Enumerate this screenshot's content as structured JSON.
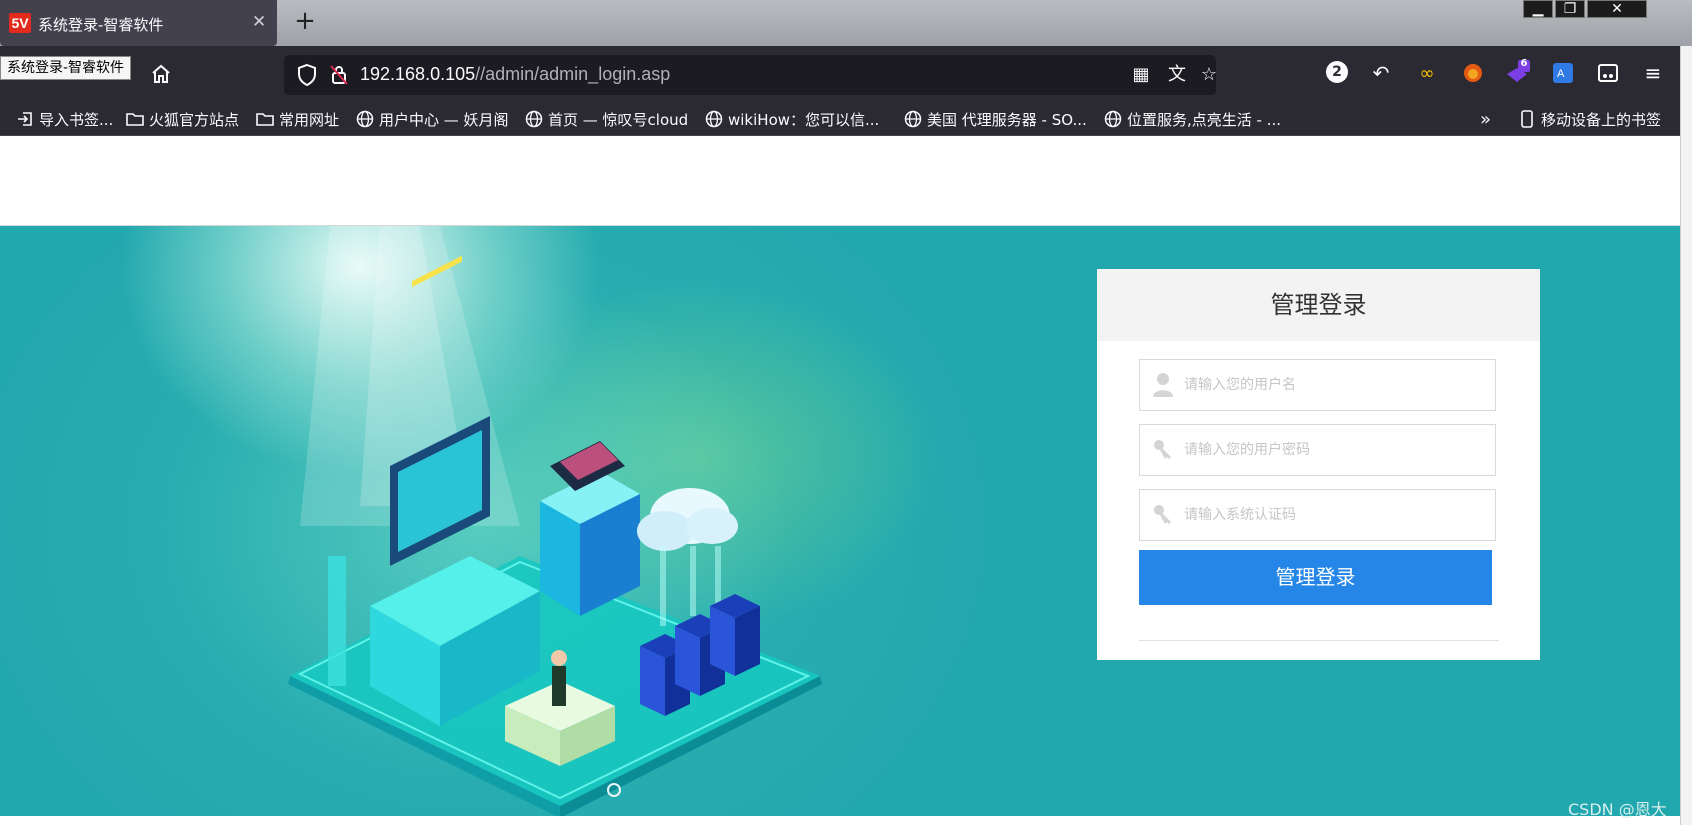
{
  "browser": {
    "tab_title": "系统登录-智睿软件",
    "tab_favicon_text": "5V",
    "tooltip": "系统登录-智睿软件",
    "url_host": "192.168.0.105",
    "url_path": "//admin/admin_login.asp",
    "badge_count": "2",
    "extension_badge": "6",
    "bookmarks": [
      {
        "label": "导入书签...",
        "icon": "import-icon"
      },
      {
        "label": "火狐官方站点",
        "icon": "folder-icon"
      },
      {
        "label": "常用网址",
        "icon": "folder-icon"
      },
      {
        "label": "用户中心 — 妖月阁",
        "icon": "globe-icon"
      },
      {
        "label": "首页 — 惊叹号cloud",
        "icon": "globe-icon"
      },
      {
        "label": "wikiHow：您可以信...",
        "icon": "globe-icon"
      },
      {
        "label": "美国 代理服务器 - SO...",
        "icon": "globe-icon"
      },
      {
        "label": "位置服务,点亮生活 - ...",
        "icon": "globe-icon"
      }
    ],
    "mobile_bookmarks": "移动设备上的书签"
  },
  "login": {
    "title": "管理登录",
    "username_placeholder": "请输入您的用户名",
    "password_placeholder": "请输入您的用户密码",
    "captcha_placeholder": "请输入系统认证码",
    "submit_label": "管理登录"
  },
  "watermark": "CSDN @恩大",
  "colors": {
    "hero_bg": "#21a7ae",
    "button": "#2586e8",
    "browser_dark": "#2b2a33"
  }
}
